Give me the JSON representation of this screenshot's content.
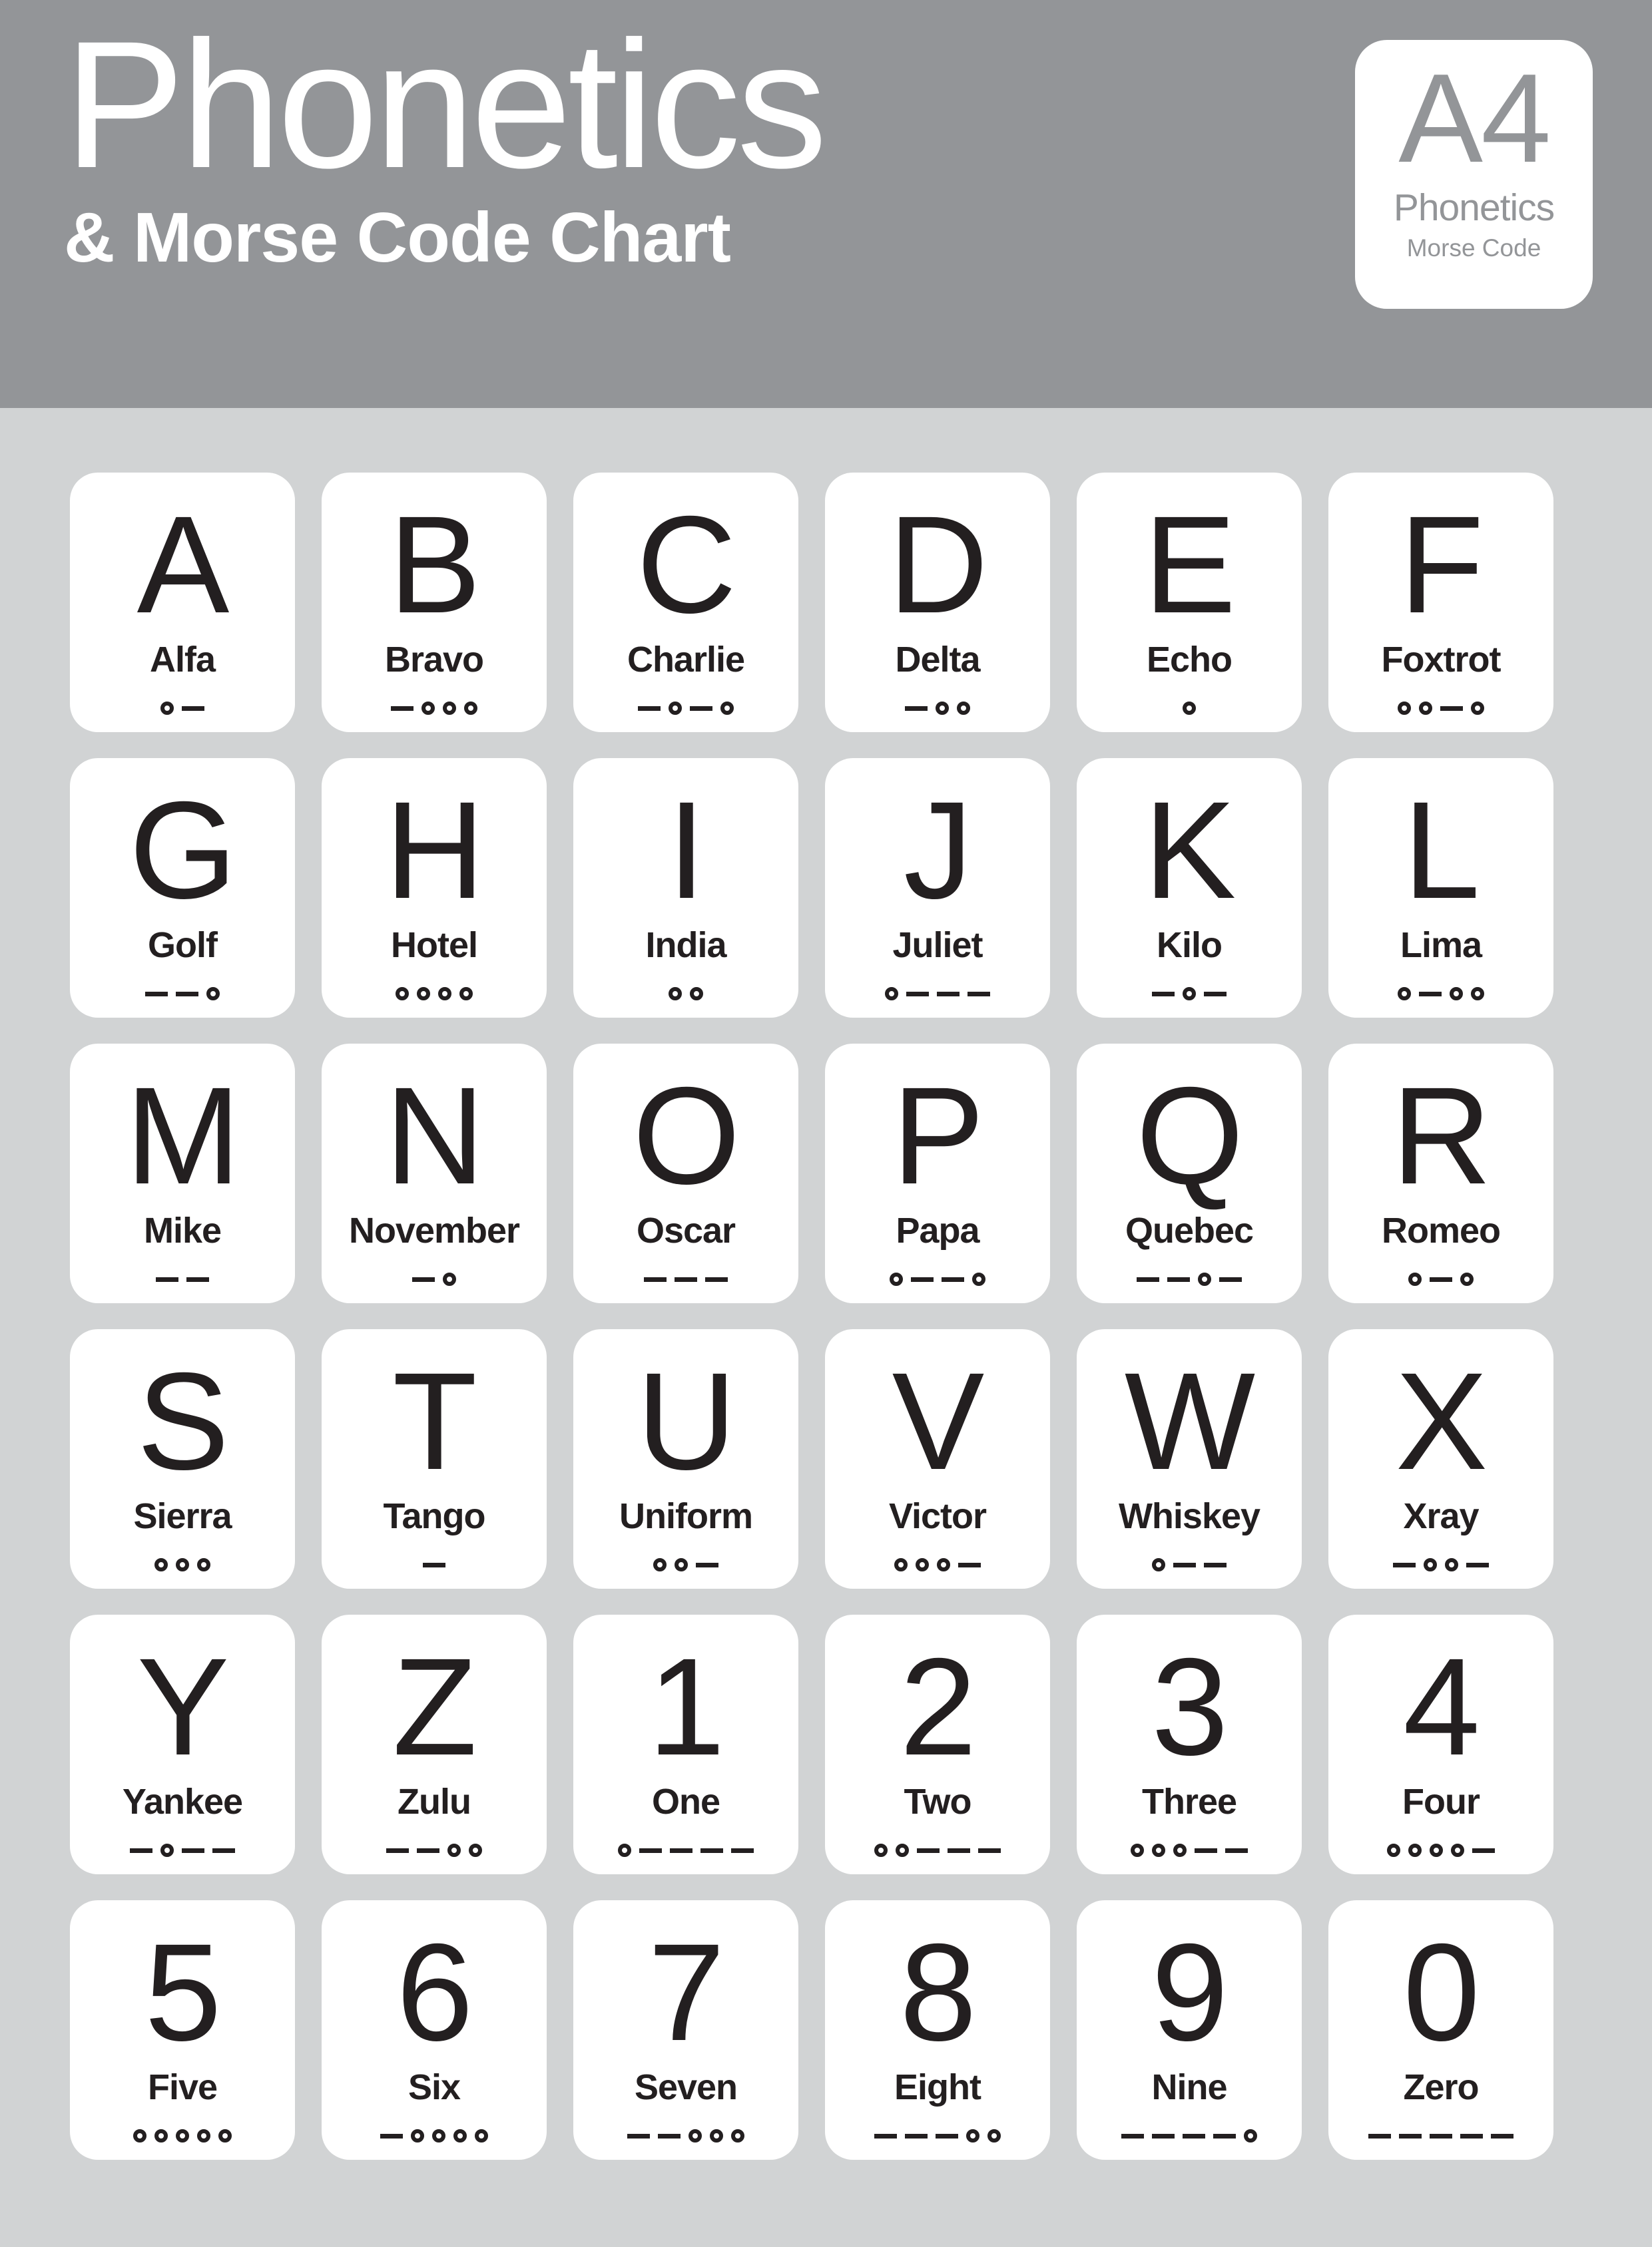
{
  "header": {
    "title": "Phonetics",
    "subtitle": "& Morse Code Chart",
    "background_color": "#939598",
    "text_color": "#ffffff"
  },
  "badge": {
    "code": "A4",
    "line1": "Phonetics",
    "line2": "Morse Code",
    "background_color": "#ffffff",
    "text_color": "#939598"
  },
  "page": {
    "background_color": "#d1d3d4",
    "card_color": "#ffffff",
    "ink_color": "#231f20"
  },
  "cards": [
    {
      "glyph": "A",
      "word": "Alfa",
      "morse": ".-"
    },
    {
      "glyph": "B",
      "word": "Bravo",
      "morse": "-..."
    },
    {
      "glyph": "C",
      "word": "Charlie",
      "morse": "-.-."
    },
    {
      "glyph": "D",
      "word": "Delta",
      "morse": "-.."
    },
    {
      "glyph": "E",
      "word": "Echo",
      "morse": "."
    },
    {
      "glyph": "F",
      "word": "Foxtrot",
      "morse": "..-."
    },
    {
      "glyph": "G",
      "word": "Golf",
      "morse": "--."
    },
    {
      "glyph": "H",
      "word": "Hotel",
      "morse": "...."
    },
    {
      "glyph": "I",
      "word": "India",
      "morse": ".."
    },
    {
      "glyph": "J",
      "word": "Juliet",
      "morse": ".---"
    },
    {
      "glyph": "K",
      "word": "Kilo",
      "morse": "-.-"
    },
    {
      "glyph": "L",
      "word": "Lima",
      "morse": ".-.."
    },
    {
      "glyph": "M",
      "word": "Mike",
      "morse": "--"
    },
    {
      "glyph": "N",
      "word": "November",
      "morse": "-."
    },
    {
      "glyph": "O",
      "word": "Oscar",
      "morse": "---"
    },
    {
      "glyph": "P",
      "word": "Papa",
      "morse": ".--."
    },
    {
      "glyph": "Q",
      "word": "Quebec",
      "morse": "--.-"
    },
    {
      "glyph": "R",
      "word": "Romeo",
      "morse": ".-."
    },
    {
      "glyph": "S",
      "word": "Sierra",
      "morse": "..."
    },
    {
      "glyph": "T",
      "word": "Tango",
      "morse": "-"
    },
    {
      "glyph": "U",
      "word": "Uniform",
      "morse": "..-"
    },
    {
      "glyph": "V",
      "word": "Victor",
      "morse": "...-"
    },
    {
      "glyph": "W",
      "word": "Whiskey",
      "morse": ".--"
    },
    {
      "glyph": "X",
      "word": "Xray",
      "morse": "-..-"
    },
    {
      "glyph": "Y",
      "word": "Yankee",
      "morse": "-.--"
    },
    {
      "glyph": "Z",
      "word": "Zulu",
      "morse": "--.."
    },
    {
      "glyph": "1",
      "word": "One",
      "morse": ".----"
    },
    {
      "glyph": "2",
      "word": "Two",
      "morse": "..---"
    },
    {
      "glyph": "3",
      "word": "Three",
      "morse": "...--"
    },
    {
      "glyph": "4",
      "word": "Four",
      "morse": "....-"
    },
    {
      "glyph": "5",
      "word": "Five",
      "morse": "....."
    },
    {
      "glyph": "6",
      "word": "Six",
      "morse": "-...."
    },
    {
      "glyph": "7",
      "word": "Seven",
      "morse": "--..."
    },
    {
      "glyph": "8",
      "word": "Eight",
      "morse": "---.."
    },
    {
      "glyph": "9",
      "word": "Nine",
      "morse": "----."
    },
    {
      "glyph": "0",
      "word": "Zero",
      "morse": "-----"
    }
  ]
}
